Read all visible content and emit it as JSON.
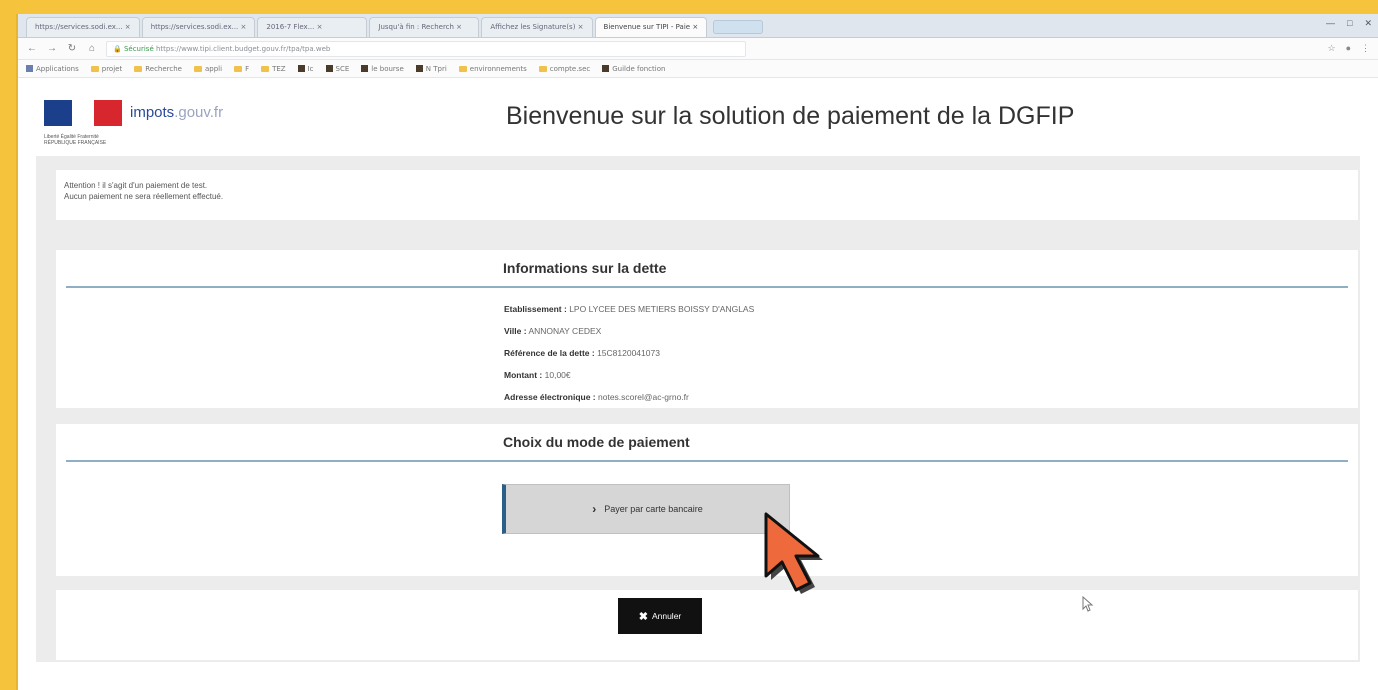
{
  "browser": {
    "tabs": [
      "https://services.sodi.ex... ×",
      "https://services.sodi.ex... ×",
      "2016-7 Flex... ×",
      "Jusqu'à fin : Recherch ×",
      "Affichez les Signature(s) ×",
      "Bienvenue sur TIPI - Paie ×"
    ],
    "url_secure_label": "Sécurisé",
    "url": "https://www.tipi.client.budget.gouv.fr/tpa/tpa.web",
    "bookmarks": [
      "Applications",
      "projet",
      "Recherche",
      "appli",
      "F",
      "TEZ",
      "Ic",
      "SCE",
      "le bourse",
      "N Tpri",
      "environnements",
      "compte.sec",
      "Guilde fonction"
    ]
  },
  "header": {
    "logo_text": "impots",
    "logo_domain": ".gouv.fr",
    "logo_motto": "Liberté Égalité Fraternité RÉPUBLIQUE FRANÇAISE",
    "page_title": "Bienvenue sur la solution de paiement de la DGFIP"
  },
  "notice": {
    "line1": "Attention ! il s'agit d'un paiement de test.",
    "line2": "Aucun paiement ne sera réellement effectué."
  },
  "debt_info": {
    "title": "Informations sur la dette",
    "rows": [
      {
        "label": "Etablissement :",
        "value": "LPO LYCEE DES METIERS BOISSY D'ANGLAS"
      },
      {
        "label": "Ville :",
        "value": "ANNONAY CEDEX"
      },
      {
        "label": "Référence de la dette :",
        "value": "15C8120041073"
      },
      {
        "label": "Montant :",
        "value": "10,00€"
      },
      {
        "label": "Adresse électronique :",
        "value": "notes.scorel@ac-grno.fr"
      }
    ]
  },
  "payment": {
    "title": "Choix du mode de paiement",
    "card_button": "Payer par carte bancaire"
  },
  "actions": {
    "cancel_label": "Annuler"
  }
}
